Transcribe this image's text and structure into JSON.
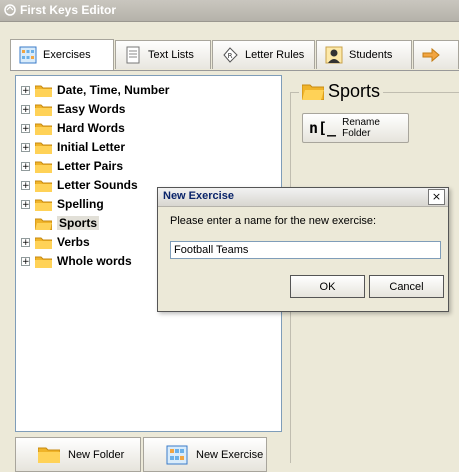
{
  "window": {
    "title": "First Keys Editor"
  },
  "tabs": [
    {
      "label": "Exercises",
      "icon": "exercises-grid-icon"
    },
    {
      "label": "Text Lists",
      "icon": "document-list-icon"
    },
    {
      "label": "Letter Rules",
      "icon": "letter-rules-icon"
    },
    {
      "label": "Students",
      "icon": "student-icon"
    },
    {
      "label": "",
      "icon": "arrow-right-icon"
    }
  ],
  "tree": {
    "items": [
      {
        "label": "Date, Time, Number",
        "expandable": true
      },
      {
        "label": "Easy Words",
        "expandable": true
      },
      {
        "label": "Hard Words",
        "expandable": true
      },
      {
        "label": "Initial Letter",
        "expandable": true
      },
      {
        "label": "Letter Pairs",
        "expandable": true
      },
      {
        "label": "Letter Sounds",
        "expandable": true
      },
      {
        "label": "Spelling",
        "expandable": true
      },
      {
        "label": "Sports",
        "expandable": false,
        "selected": true
      },
      {
        "label": "Verbs",
        "expandable": true
      },
      {
        "label": "Whole words",
        "expandable": true
      }
    ]
  },
  "folder_panel": {
    "title": "Sports",
    "rename_label": "Rename Folder"
  },
  "bottom": {
    "new_folder_label": "New Folder",
    "new_exercise_label": "New Exercise"
  },
  "dialog": {
    "title": "New Exercise",
    "close_label": "×",
    "prompt": "Please enter a name for the new exercise:",
    "input_value": "Football Teams",
    "ok_label": "OK",
    "cancel_label": "Cancel"
  },
  "colors": {
    "folder": "#f0b429",
    "selection": "#e2e0d8",
    "border": "#7f9db9"
  }
}
